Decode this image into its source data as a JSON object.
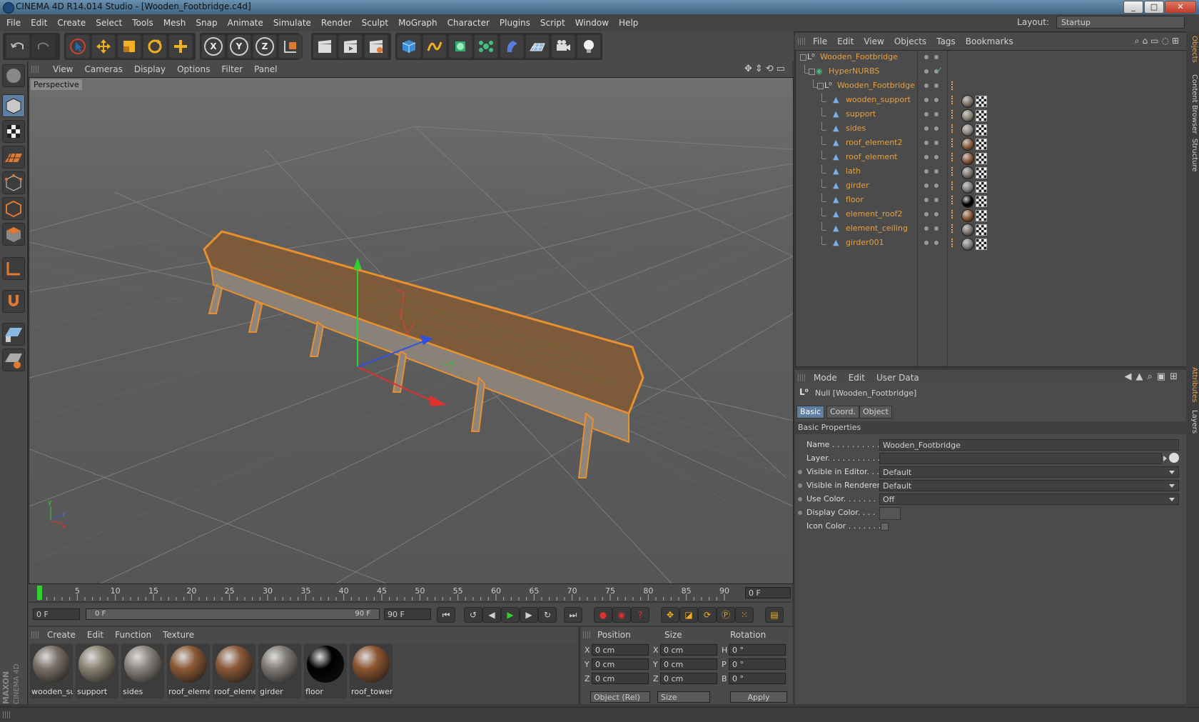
{
  "window": {
    "title": "CINEMA 4D R14.014 Studio - [Wooden_Footbridge.c4d]",
    "controls": [
      "_",
      "□",
      "✕"
    ]
  },
  "menu": [
    "File",
    "Edit",
    "Create",
    "Select",
    "Tools",
    "Mesh",
    "Snap",
    "Animate",
    "Simulate",
    "Render",
    "Sculpt",
    "MoGraph",
    "Character",
    "Plugins",
    "Script",
    "Window",
    "Help"
  ],
  "layout": {
    "label": "Layout:",
    "value": "Startup"
  },
  "toolbar": {
    "axis_x": "X",
    "axis_y": "Y",
    "axis_z": "Z"
  },
  "viewport": {
    "menu": [
      "View",
      "Cameras",
      "Display",
      "Options",
      "Filter",
      "Panel"
    ],
    "label": "Perspective"
  },
  "timeline": {
    "ticks": [
      "0",
      "5",
      "10",
      "15",
      "20",
      "25",
      "30",
      "35",
      "40",
      "45",
      "50",
      "55",
      "60",
      "65",
      "70",
      "75",
      "80",
      "85",
      "90"
    ],
    "current_frame": "0 F"
  },
  "transport": {
    "start": "0 F",
    "range_start": "0 F",
    "range_end": "90 F",
    "end": "90 F"
  },
  "materials": {
    "menu": [
      "Create",
      "Edit",
      "Function",
      "Texture"
    ],
    "items": [
      {
        "label": "wooden_su",
        "color": "#7a6f66"
      },
      {
        "label": "support",
        "color": "#8a8373"
      },
      {
        "label": "sides",
        "color": "#8d8680"
      },
      {
        "label": "roof_eleme",
        "color": "#8c5a36"
      },
      {
        "label": "roof_eleme",
        "color": "#8a5838"
      },
      {
        "label": "girder",
        "color": "#7f7b76"
      },
      {
        "label": "floor",
        "color": "#000000"
      },
      {
        "label": "roof_tower",
        "color": "#8c5530"
      }
    ]
  },
  "coordinates": {
    "headers": [
      "Position",
      "Size",
      "Rotation"
    ],
    "rows": [
      {
        "axis": "X",
        "pos": "0 cm",
        "size_axis": "X",
        "size": "0 cm",
        "rot_axis": "H",
        "rot": "0 °"
      },
      {
        "axis": "Y",
        "pos": "0 cm",
        "size_axis": "Y",
        "size": "0 cm",
        "rot_axis": "P",
        "rot": "0 °"
      },
      {
        "axis": "Z",
        "pos": "0 cm",
        "size_axis": "Z",
        "size": "0 cm",
        "rot_axis": "B",
        "rot": "0 °"
      }
    ],
    "mode": "Object (Rel)",
    "size_mode": "Size",
    "apply": "Apply"
  },
  "object_manager": {
    "menu": [
      "File",
      "Edit",
      "View",
      "Objects",
      "Tags",
      "Bookmarks"
    ],
    "objects": [
      {
        "name": "Wooden_Footbridge",
        "level": 0,
        "kind": "null"
      },
      {
        "name": "HyperNURBS",
        "level": 1,
        "kind": "hypernurbs"
      },
      {
        "name": "Wooden_Footbridge",
        "level": 2,
        "kind": "null"
      },
      {
        "name": "wooden_support",
        "level": 3,
        "kind": "poly",
        "tag": "#7a6f66"
      },
      {
        "name": "support",
        "level": 3,
        "kind": "poly",
        "tag": "#8a8373"
      },
      {
        "name": "sides",
        "level": 3,
        "kind": "poly",
        "tag": "#8d8680"
      },
      {
        "name": "roof_element2",
        "level": 3,
        "kind": "poly",
        "tag": "#8c5a36"
      },
      {
        "name": "roof_element",
        "level": 3,
        "kind": "poly",
        "tag": "#8a5838"
      },
      {
        "name": "lath",
        "level": 3,
        "kind": "poly",
        "tag": "#7a6f66"
      },
      {
        "name": "girder",
        "level": 3,
        "kind": "poly",
        "tag": "#7f7b76"
      },
      {
        "name": "floor",
        "level": 3,
        "kind": "poly",
        "tag": "#000000"
      },
      {
        "name": "element_roof2",
        "level": 3,
        "kind": "poly",
        "tag": "#8c5530"
      },
      {
        "name": "element_ceiling",
        "level": 3,
        "kind": "poly",
        "tag": "#7a6f66"
      },
      {
        "name": "girder001",
        "level": 3,
        "kind": "poly",
        "tag": "#7f7b76"
      }
    ]
  },
  "attributes": {
    "menu": [
      "Mode",
      "Edit",
      "User Data"
    ],
    "object_title": "Null [Wooden_Footbridge]",
    "tabs": [
      "Basic",
      "Coord.",
      "Object"
    ],
    "section": "Basic Properties",
    "fields": [
      {
        "label": "Name . . . . . . . . . . . .",
        "value": "Wooden_Footbridge"
      },
      {
        "label": "Layer. . . . . . . . . . . .",
        "value": ""
      },
      {
        "label": "Visible in Editor. . .",
        "value": "Default"
      },
      {
        "label": "Visible in Renderer",
        "value": "Default"
      },
      {
        "label": "Use Color. . . . . . . .",
        "value": "Off"
      },
      {
        "label": "Display Color. . . .",
        "value": ""
      },
      {
        "label": "Icon Color . . . . . . .",
        "value": ""
      }
    ]
  },
  "side_tabs": [
    "Objects",
    "Content Browser",
    "Structure",
    "Attributes",
    "Layers"
  ],
  "brand": "MAXON CINEMA 4D",
  "colors": {
    "selection": "#e8a040",
    "accent": "#5d7fa4"
  }
}
